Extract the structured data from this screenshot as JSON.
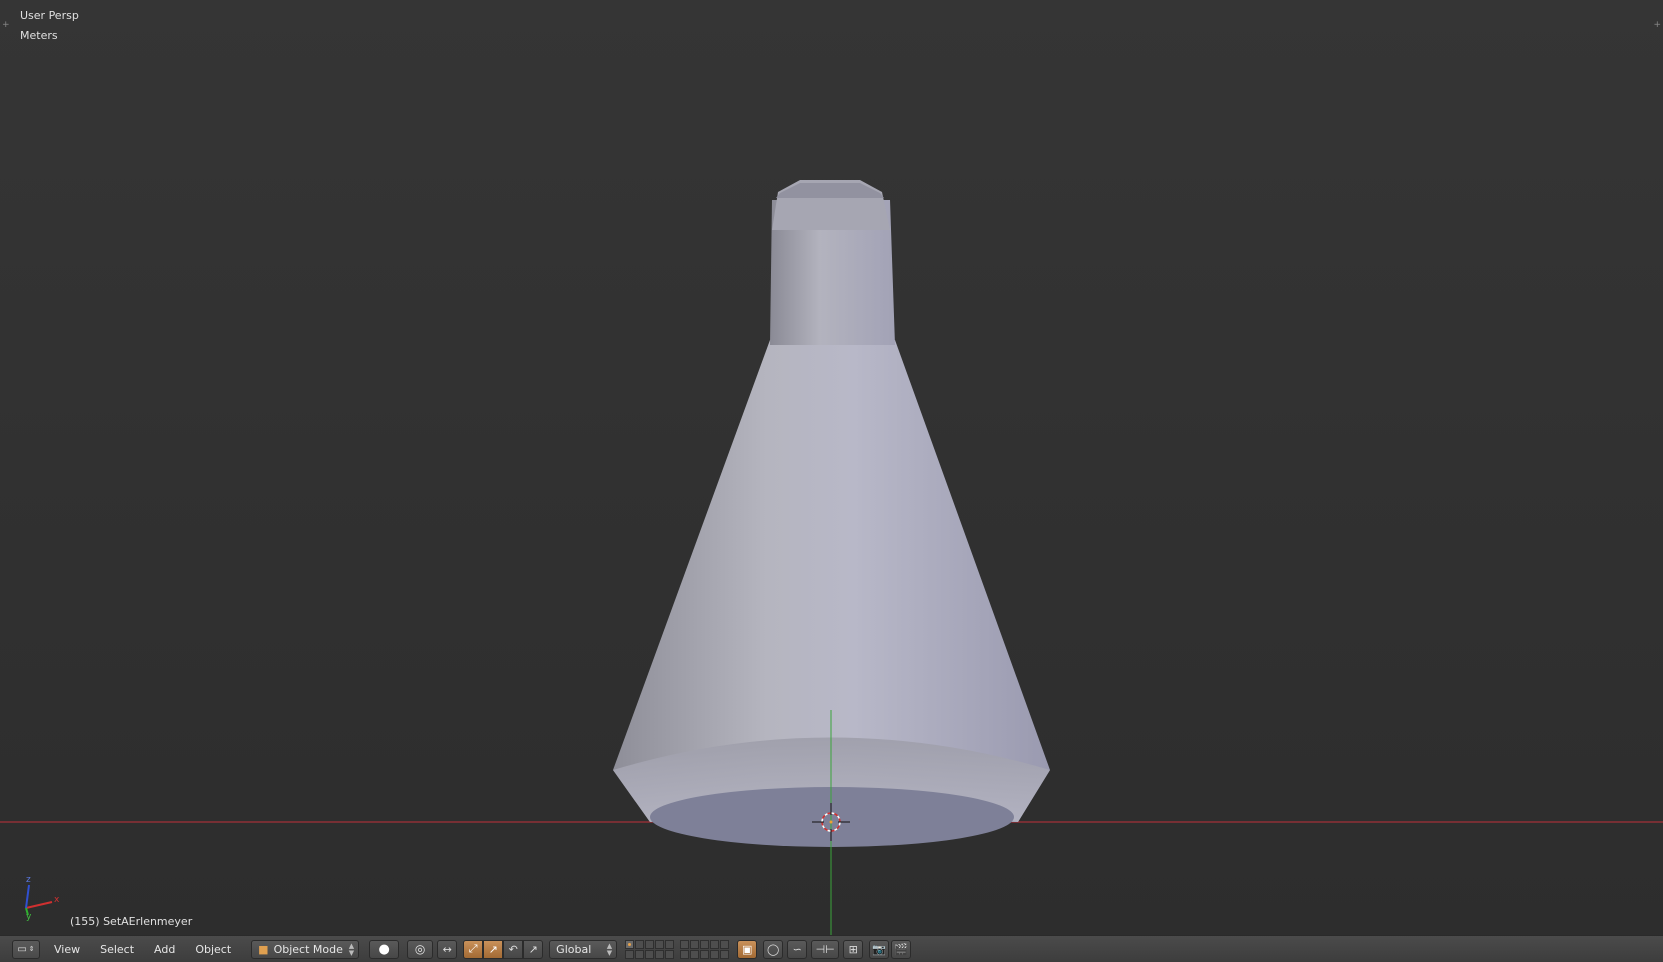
{
  "viewport": {
    "view_name": "User Persp",
    "units": "Meters",
    "object_info": "(155) SetAErlenmeyer",
    "axis_labels": {
      "x": "x",
      "y": "y",
      "z": "z"
    },
    "colors": {
      "x_axis_line": "#c0303a",
      "y_axis_line": "#3aa53a",
      "mesh_base": "#aeb0c4",
      "background": "#333333"
    }
  },
  "header": {
    "editor_type_icon": "3d-view-icon",
    "menus": [
      "View",
      "Select",
      "Add",
      "Object"
    ],
    "mode": {
      "label": "Object Mode",
      "icon": "object-cube-icon"
    },
    "shading_icon": "solid-sphere-icon",
    "pivot_icon": "pivot-point-icon",
    "manipulator_icons": [
      "manipulator-toggle-icon",
      "translate-icon",
      "rotate-icon",
      "scale-icon"
    ],
    "orientation": "Global",
    "layers": {
      "count": 20,
      "active_index": 0
    },
    "tool_icons": [
      "render-layer-icon",
      "proportional-edit-icon",
      "falloff-icon",
      "snap-icon",
      "snap-target-icon",
      "opengl-render-icon",
      "render-anim-icon"
    ],
    "accent": "#c9915a"
  }
}
